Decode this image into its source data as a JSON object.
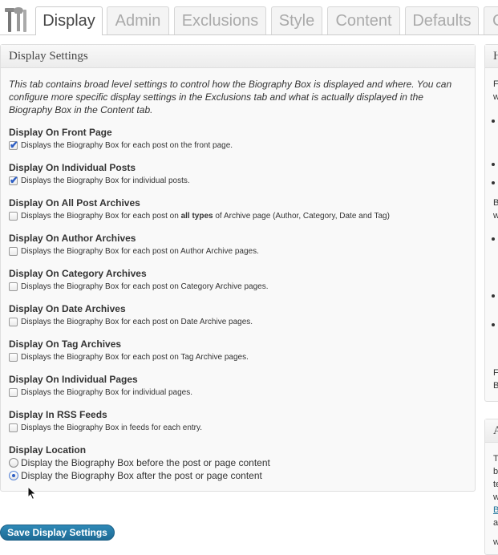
{
  "tabs": [
    {
      "label": "Display",
      "active": true
    },
    {
      "label": "Admin",
      "active": false
    },
    {
      "label": "Exclusions",
      "active": false
    },
    {
      "label": "Style",
      "active": false
    },
    {
      "label": "Content",
      "active": false
    },
    {
      "label": "Defaults",
      "active": false
    },
    {
      "label": "C",
      "active": false
    }
  ],
  "panel": {
    "title": "Display Settings",
    "intro": "This tab contains broad level settings to control how the Biography Box is displayed and where. You can configure more specific display settings in the Exclusions tab and what is actually displayed in the Biography Box in the Content tab.",
    "settings": [
      {
        "label": "Display On Front Page",
        "checked": true,
        "desc": "Displays the Biography Box for each post on the front page."
      },
      {
        "label": "Display On Individual Posts",
        "checked": true,
        "desc": "Displays the Biography Box for individual posts."
      },
      {
        "label": "Display On All Post Archives",
        "checked": false,
        "desc_pre": "Displays the Biography Box for each post on ",
        "desc_bold": "all types",
        "desc_post": " of Archive page (Author, Category, Date and Tag)"
      },
      {
        "label": "Display On Author Archives",
        "checked": false,
        "desc": "Displays the Biography Box for each post on Author Archive pages."
      },
      {
        "label": "Display On Category Archives",
        "checked": false,
        "desc": "Displays the Biography Box for each post on Category Archive pages."
      },
      {
        "label": "Display On Date Archives",
        "checked": false,
        "desc": "Displays the Biography Box for each post on Date Archive pages."
      },
      {
        "label": "Display On Tag Archives",
        "checked": false,
        "desc": "Displays the Biography Box for each post on Tag Archive pages."
      },
      {
        "label": "Display On Individual Pages",
        "checked": false,
        "desc": "Displays the Biography Box for individual pages."
      },
      {
        "label": "Display In RSS Feeds",
        "checked": false,
        "desc": "Displays the Biography Box in feeds for each entry."
      }
    ],
    "location": {
      "label": "Display Location",
      "options": [
        {
          "label": "Display the Biography Box before the post or page content",
          "selected": false
        },
        {
          "label": "Display the Biography Box after the post or page content",
          "selected": true
        }
      ]
    }
  },
  "save_button": {
    "label": "Save Display Settings"
  },
  "side": {
    "box1_title": "H",
    "box1_frags": [
      "F",
      "w",
      "B",
      "w",
      "F",
      "B"
    ],
    "box2_title": "A",
    "box2_frags": [
      "T",
      "b",
      "te",
      "w",
      "a",
      "w"
    ],
    "box2_link": "B"
  },
  "colors": {
    "accent": "#21759b",
    "button": "#2479a8",
    "panel_bg": "#f9f9f9",
    "border": "#dfdfdf"
  }
}
